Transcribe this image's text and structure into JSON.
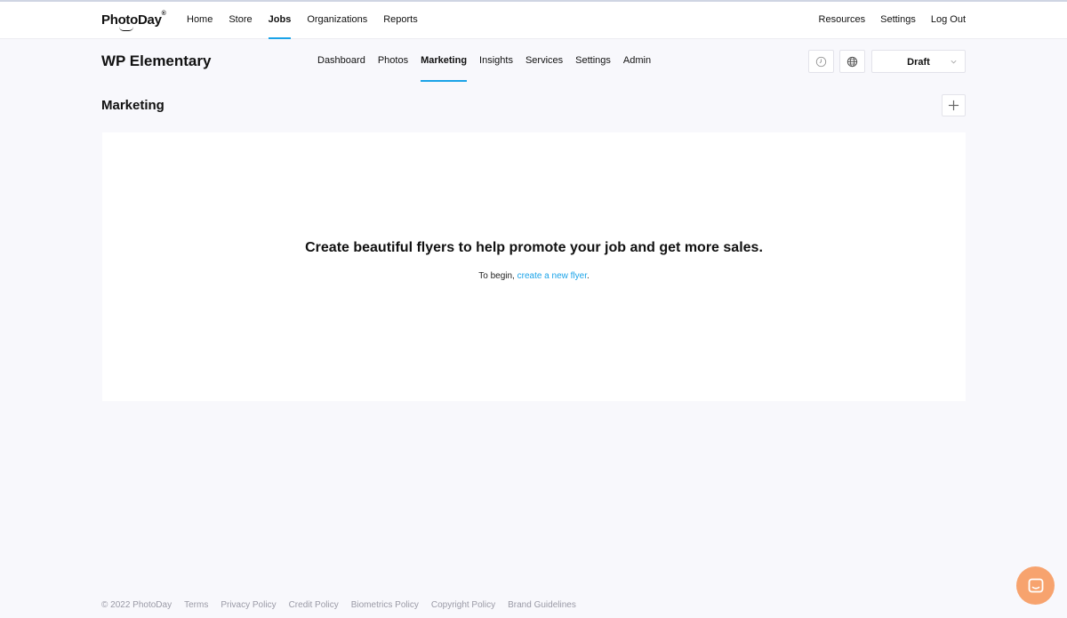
{
  "brand": {
    "name": "PhotoDay",
    "tm": "®"
  },
  "top_nav": {
    "items": [
      {
        "label": "Home",
        "active": false
      },
      {
        "label": "Store",
        "active": false
      },
      {
        "label": "Jobs",
        "active": true
      },
      {
        "label": "Organizations",
        "active": false
      },
      {
        "label": "Reports",
        "active": false
      }
    ],
    "right": [
      "Resources",
      "Settings",
      "Log Out"
    ]
  },
  "job": {
    "title": "WP Elementary",
    "tabs": [
      {
        "label": "Dashboard",
        "active": false
      },
      {
        "label": "Photos",
        "active": false
      },
      {
        "label": "Marketing",
        "active": true
      },
      {
        "label": "Insights",
        "active": false
      },
      {
        "label": "Services",
        "active": false
      },
      {
        "label": "Settings",
        "active": false
      },
      {
        "label": "Admin",
        "active": false
      }
    ],
    "icons": [
      "clock-icon",
      "globe-icon"
    ],
    "status_select": {
      "value": "Draft"
    }
  },
  "section": {
    "title": "Marketing",
    "add_icon": "plus-icon"
  },
  "empty_state": {
    "headline": "Create beautiful flyers to help promote your job and get more sales.",
    "prefix": "To begin, ",
    "link": "create a new flyer",
    "suffix": "."
  },
  "footer": {
    "copyright": "© 2022 PhotoDay",
    "links": [
      "Terms",
      "Privacy Policy",
      "Credit Policy",
      "Biometrics Policy",
      "Copyright Policy",
      "Brand Guidelines"
    ]
  },
  "colors": {
    "accent": "#1aa3e8",
    "chat": "#f7a36e",
    "background": "#f8f8fc"
  }
}
